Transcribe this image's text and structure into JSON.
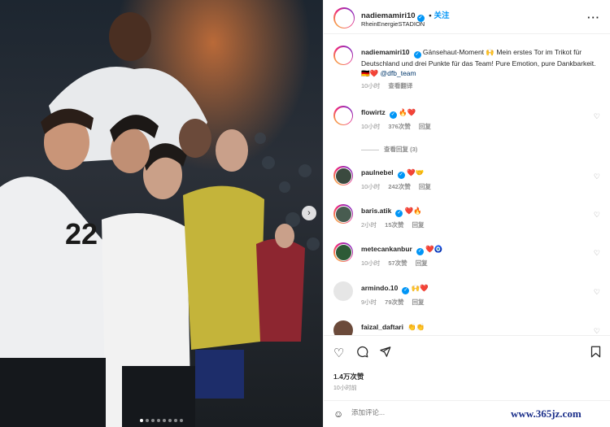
{
  "post": {
    "username": "nadiemamiri10",
    "verified_mark": "✓",
    "follow_dot": "•",
    "follow_label": "关注",
    "location": "RheinEnergieSTADION",
    "more": "···"
  },
  "caption": {
    "username": "nadiemamiri10",
    "text": "Gänsehaut-Moment 🙌 Mein erstes Tor im Trikot für Deutschland und drei Punkte für das Team! Pure Emotion, pure Dankbarkeit. 🇩🇪❤️",
    "mention": "@dfb_team",
    "time": "10小时",
    "translate": "查看翻译"
  },
  "comments": [
    {
      "username": "flowirtz",
      "text": "🔥❤️",
      "time": "10小时",
      "likes": "376次赞",
      "reply": "回复"
    },
    {
      "username": "paulnebel",
      "text": "❤️🤝",
      "time": "10小时",
      "likes": "242次赞",
      "reply": "回复"
    },
    {
      "username": "baris.atik",
      "text": "❤️🔥",
      "time": "2小时",
      "likes": "15次赞",
      "reply": "回复"
    },
    {
      "username": "metecankanbur",
      "text": "❤️🧿",
      "time": "10小时",
      "likes": "57次赞",
      "reply": "回复"
    },
    {
      "username": "armindo.10",
      "text": "🙌❤️",
      "time": "9小时",
      "likes": "79次赞",
      "reply": "回复"
    },
    {
      "username": "faizal_daftari",
      "text": "👏👏",
      "time": "",
      "likes": "",
      "reply": ""
    }
  ],
  "view_replies": "查看回复 (3)",
  "likes_count": "1.4万次赞",
  "post_time": "10小时前",
  "add_comment": {
    "placeholder": "添加评论..."
  },
  "watermark": "www.365jz.com",
  "icons": {
    "like": "heart-icon",
    "comment": "comment-icon",
    "share": "share-icon",
    "save": "bookmark-icon",
    "emoji": "emoji-icon",
    "next": "chevron-right-icon"
  },
  "colors": {
    "accent": "#0095f6",
    "heart": "#ed4956",
    "muted": "#8e8e8e"
  }
}
